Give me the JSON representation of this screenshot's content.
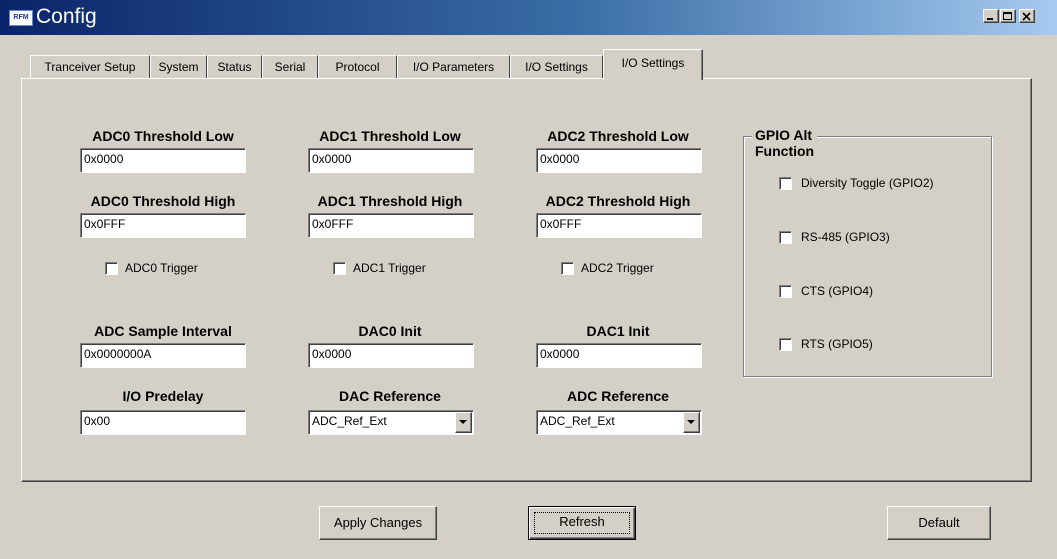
{
  "window": {
    "title": "Config",
    "icon_text": "RFM"
  },
  "tabs": [
    {
      "label": "Tranceiver Setup"
    },
    {
      "label": "System"
    },
    {
      "label": "Status"
    },
    {
      "label": "Serial"
    },
    {
      "label": "Protocol"
    },
    {
      "label": "I/O Parameters"
    },
    {
      "label": "I/O Settings"
    },
    {
      "label": "I/O Settings",
      "active": true
    }
  ],
  "adc_thresholds": [
    {
      "low_label": "ADC0 Threshold Low",
      "low_value": "0x0000",
      "high_label": "ADC0 Threshold High",
      "high_value": "0x0FFF",
      "trigger_label": "ADC0 Trigger",
      "trigger_checked": false
    },
    {
      "low_label": "ADC1 Threshold Low",
      "low_value": "0x0000",
      "high_label": "ADC1 Threshold High",
      "high_value": "0x0FFF",
      "trigger_label": "ADC1 Trigger",
      "trigger_checked": false
    },
    {
      "low_label": "ADC2 Threshold Low",
      "low_value": "0x0000",
      "high_label": "ADC2 Threshold High",
      "high_value": "0x0FFF",
      "trigger_label": "ADC2 Trigger",
      "trigger_checked": false
    }
  ],
  "sample_interval": {
    "label": "ADC Sample Interval",
    "value": "0x0000000A"
  },
  "dac0_init": {
    "label": "DAC0 Init",
    "value": "0x0000"
  },
  "dac1_init": {
    "label": "DAC1 Init",
    "value": "0x0000"
  },
  "io_predelay": {
    "label": "I/O Predelay",
    "value": "0x00"
  },
  "dac_reference": {
    "label": "DAC Reference",
    "selected": "ADC_Ref_Ext"
  },
  "adc_reference": {
    "label": "ADC Reference",
    "selected": "ADC_Ref_Ext"
  },
  "gpio_group": {
    "title": "GPIO Alt Function",
    "items": [
      {
        "label": "Diversity Toggle (GPIO2)",
        "checked": false
      },
      {
        "label": "RS-485 (GPIO3)",
        "checked": false
      },
      {
        "label": "CTS (GPIO4)",
        "checked": false
      },
      {
        "label": "RTS (GPIO5)",
        "checked": false
      }
    ]
  },
  "buttons": {
    "apply": "Apply Changes",
    "refresh": "Refresh",
    "default": "Default"
  },
  "colors": {
    "face": "#d4d0c8",
    "title_start": "#0a246a",
    "title_end": "#a6caf0"
  }
}
